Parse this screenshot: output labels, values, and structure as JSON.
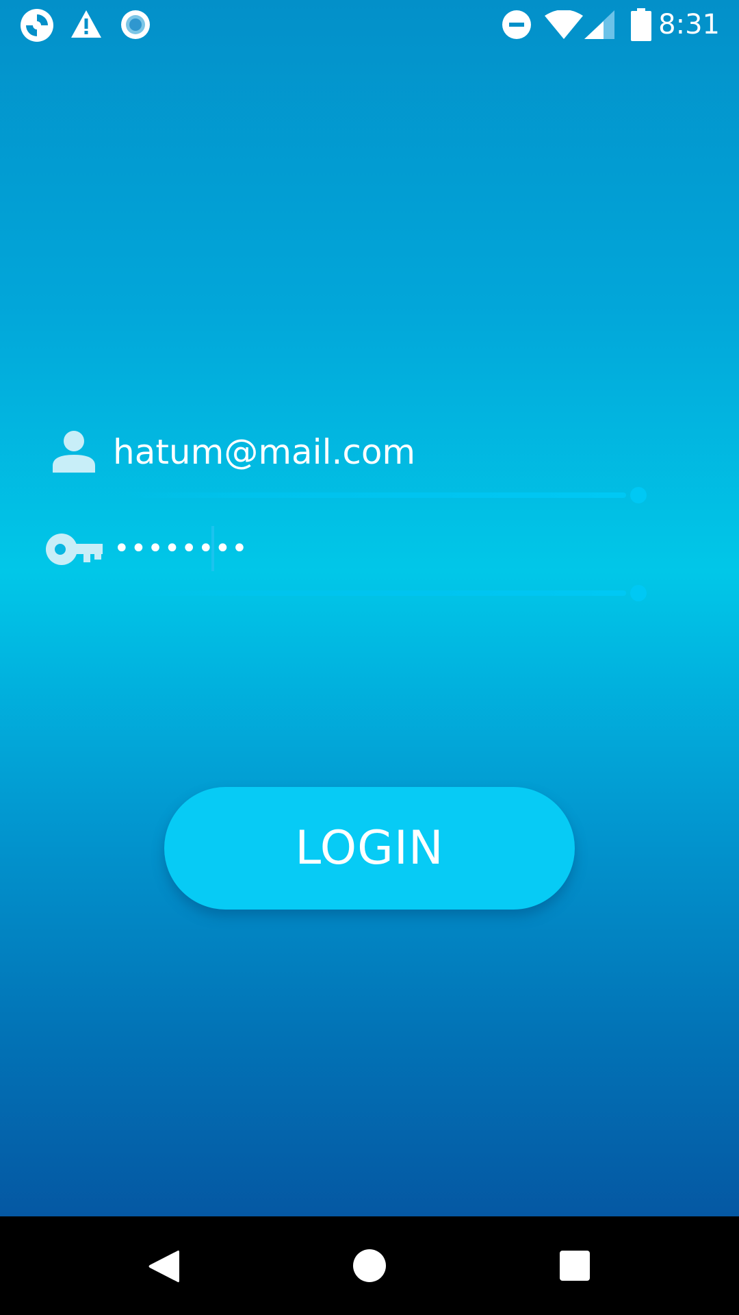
{
  "status_bar": {
    "time": "8:31",
    "left_icons": [
      "app-notification-icon",
      "warning-icon",
      "record-icon"
    ],
    "right_icons": [
      "do-not-disturb-icon",
      "wifi-icon",
      "cell-signal-icon",
      "battery-icon"
    ]
  },
  "login_form": {
    "email_icon": "person-icon",
    "email_value": "hatum@mail.com",
    "password_icon": "key-icon",
    "password_value": "••••••••",
    "login_label": "LOGIN"
  },
  "nav_bar": {
    "buttons": [
      "back-icon",
      "home-icon",
      "recents-icon"
    ]
  },
  "colors": {
    "background_top": "#0390c9",
    "background_mid": "#01c7e8",
    "background_bottom": "#0558a3",
    "accent": "#07cbf5",
    "text": "#ffffff",
    "nav_bar": "#000000"
  }
}
